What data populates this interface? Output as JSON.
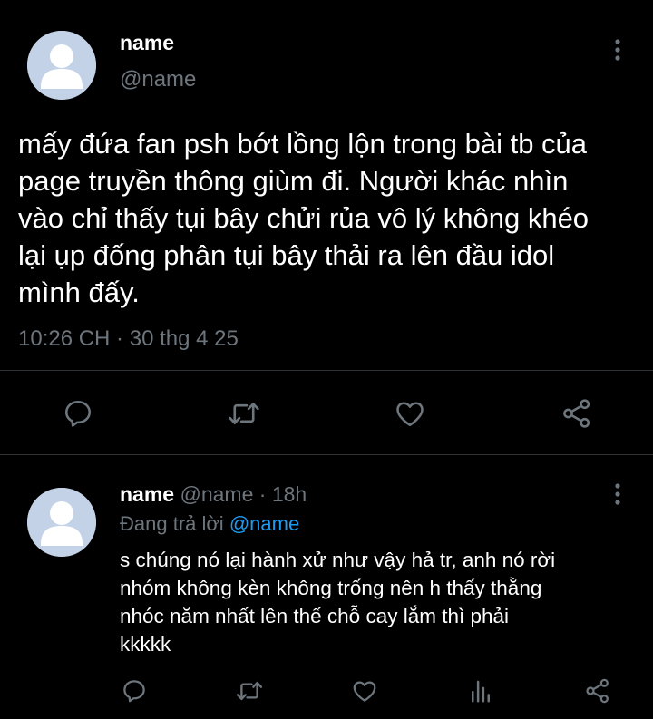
{
  "main_tweet": {
    "display_name": "name",
    "handle": "@name",
    "text": "mấy đứa fan psh bớt lồng lộn trong bài tb của\npage truyền thông giùm đi. Người khác nhìn\nvào chỉ thấy tụi bây chửi rủa vô lý không khéo\nlại ụp đống phân tụi bây thải ra lên đầu idol\nmình đấy.",
    "timestamp": "10:26 CH · 30 thg 4 25",
    "actions": [
      "reply-icon",
      "retweet-icon",
      "like-icon",
      "share-icon"
    ]
  },
  "reply_tweet": {
    "display_name": "name",
    "handle": "@name",
    "time_ago": "· 18h",
    "replying_to_label": "Đang trả lời",
    "replying_to_handle": "@name",
    "text": "s chúng nó lại hành xử như vậy hả tr, anh nó rời\nnhóm không kèn không trống nên h thấy thằng\nnhóc năm nhất lên thế chỗ cay lắm thì phải\nkkkkk",
    "actions": [
      "reply-icon",
      "retweet-icon",
      "like-icon",
      "analytics-icon",
      "share-icon"
    ]
  },
  "colors": {
    "background": "#000000",
    "text": "#ffffff",
    "muted": "#6e767d",
    "divider": "#2f3336",
    "link": "#1d9bf0",
    "avatar_bg": "#c3d2e6"
  }
}
